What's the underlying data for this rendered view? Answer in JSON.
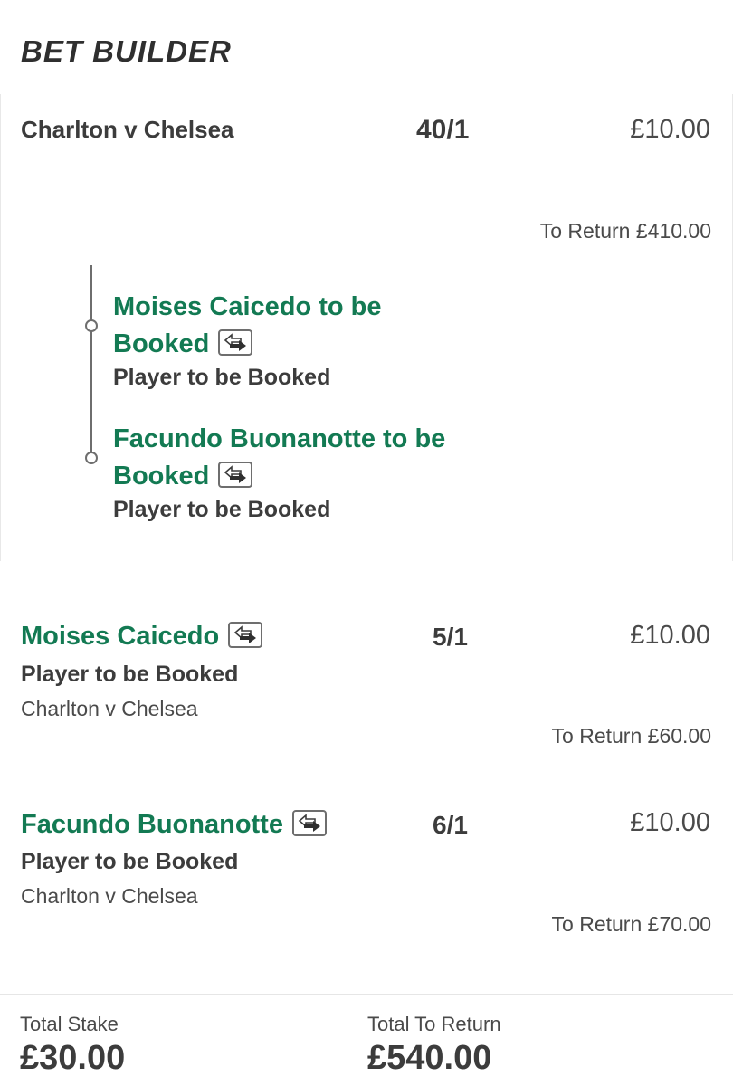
{
  "header": {
    "title": "BET BUILDER"
  },
  "bet_builder": {
    "event": "Charlton v Chelsea",
    "odds": "40/1",
    "stake": "£10.00",
    "to_return": "To Return £410.00",
    "legs": [
      {
        "selection_line1": "Moises Caicedo to be",
        "selection_line2": "Booked",
        "market": "Player to be Booked",
        "icon": "swap-icon"
      },
      {
        "selection_line1": "Facundo Buonanotte to be",
        "selection_line2": "Booked",
        "market": "Player to be Booked",
        "icon": "swap-icon"
      }
    ]
  },
  "singles": [
    {
      "selection": "Moises Caicedo",
      "market": "Player to be Booked",
      "event": "Charlton v Chelsea",
      "odds": "5/1",
      "stake": "£10.00",
      "to_return": "To Return £60.00",
      "icon": "swap-icon"
    },
    {
      "selection": "Facundo Buonanotte",
      "market": "Player to be Booked",
      "event": "Charlton v Chelsea",
      "odds": "6/1",
      "stake": "£10.00",
      "to_return": "To Return £70.00",
      "icon": "swap-icon"
    }
  ],
  "footer": {
    "total_stake_label": "Total Stake",
    "total_stake": "£30.00",
    "total_return_label": "Total To Return",
    "total_return": "£540.00"
  },
  "colors": {
    "selection_green": "#137a53",
    "text_dark": "#3c3c3c"
  }
}
